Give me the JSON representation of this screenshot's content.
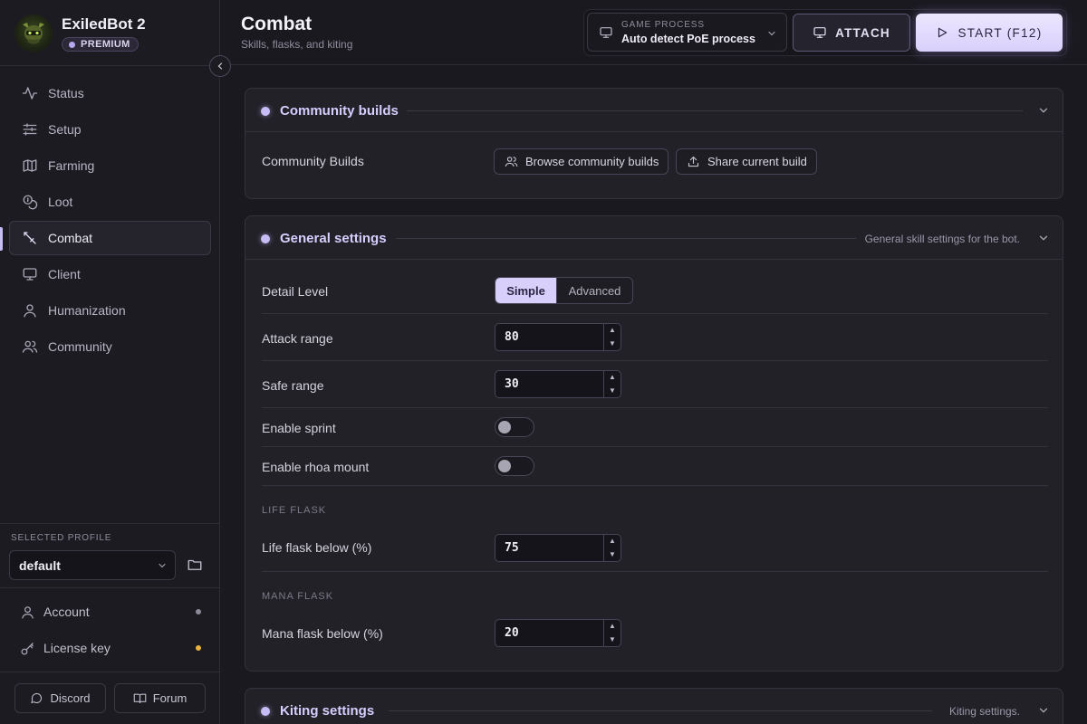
{
  "brand": {
    "name": "ExiledBot 2",
    "badge": "PREMIUM"
  },
  "sidebar": {
    "items": [
      {
        "label": "Status",
        "icon": "activity-icon",
        "active": false
      },
      {
        "label": "Setup",
        "icon": "sliders-icon",
        "active": false
      },
      {
        "label": "Farming",
        "icon": "map-icon",
        "active": false
      },
      {
        "label": "Loot",
        "icon": "coins-icon",
        "active": false
      },
      {
        "label": "Combat",
        "icon": "sword-icon",
        "active": true
      },
      {
        "label": "Client",
        "icon": "monitor-icon",
        "active": false
      },
      {
        "label": "Humanization",
        "icon": "user-icon",
        "active": false
      },
      {
        "label": "Community",
        "icon": "users-icon",
        "active": false
      }
    ],
    "profile_label": "SELECTED PROFILE",
    "profile_value": "default",
    "account": {
      "label": "Account",
      "status_color": "#8c8a96"
    },
    "license": {
      "label": "License key",
      "status_color": "#e8b33c"
    },
    "discord_label": "Discord",
    "forum_label": "Forum"
  },
  "header": {
    "title": "Combat",
    "subtitle": "Skills, flasks, and kiting",
    "process_label": "GAME PROCESS",
    "process_value": "Auto detect PoE process",
    "attach_label": "ATTACH",
    "start_label": "START (F12)"
  },
  "community_card": {
    "title": "Community builds",
    "row_label": "Community Builds",
    "browse_label": "Browse community builds",
    "share_label": "Share current build"
  },
  "general_card": {
    "title": "General settings",
    "description": "General skill settings for the bot.",
    "detail_label": "Detail Level",
    "detail_options": [
      "Simple",
      "Advanced"
    ],
    "detail_selected": "Simple",
    "attack_range_label": "Attack range",
    "attack_range_value": "80",
    "safe_range_label": "Safe range",
    "safe_range_value": "30",
    "sprint_label": "Enable sprint",
    "sprint_on": false,
    "rhoa_label": "Enable rhoa mount",
    "rhoa_on": false,
    "life_section": "LIFE FLASK",
    "life_label": "Life flask below (%)",
    "life_value": "75",
    "mana_section": "MANA FLASK",
    "mana_label": "Mana flask below (%)",
    "mana_value": "20"
  },
  "kiting_card": {
    "title": "Kiting settings",
    "description": "Kiting settings."
  },
  "colors": {
    "accent": "#c8bcf6",
    "start_bg": "#ddd4fc",
    "panel": "#222128",
    "bg": "#1a1920"
  }
}
